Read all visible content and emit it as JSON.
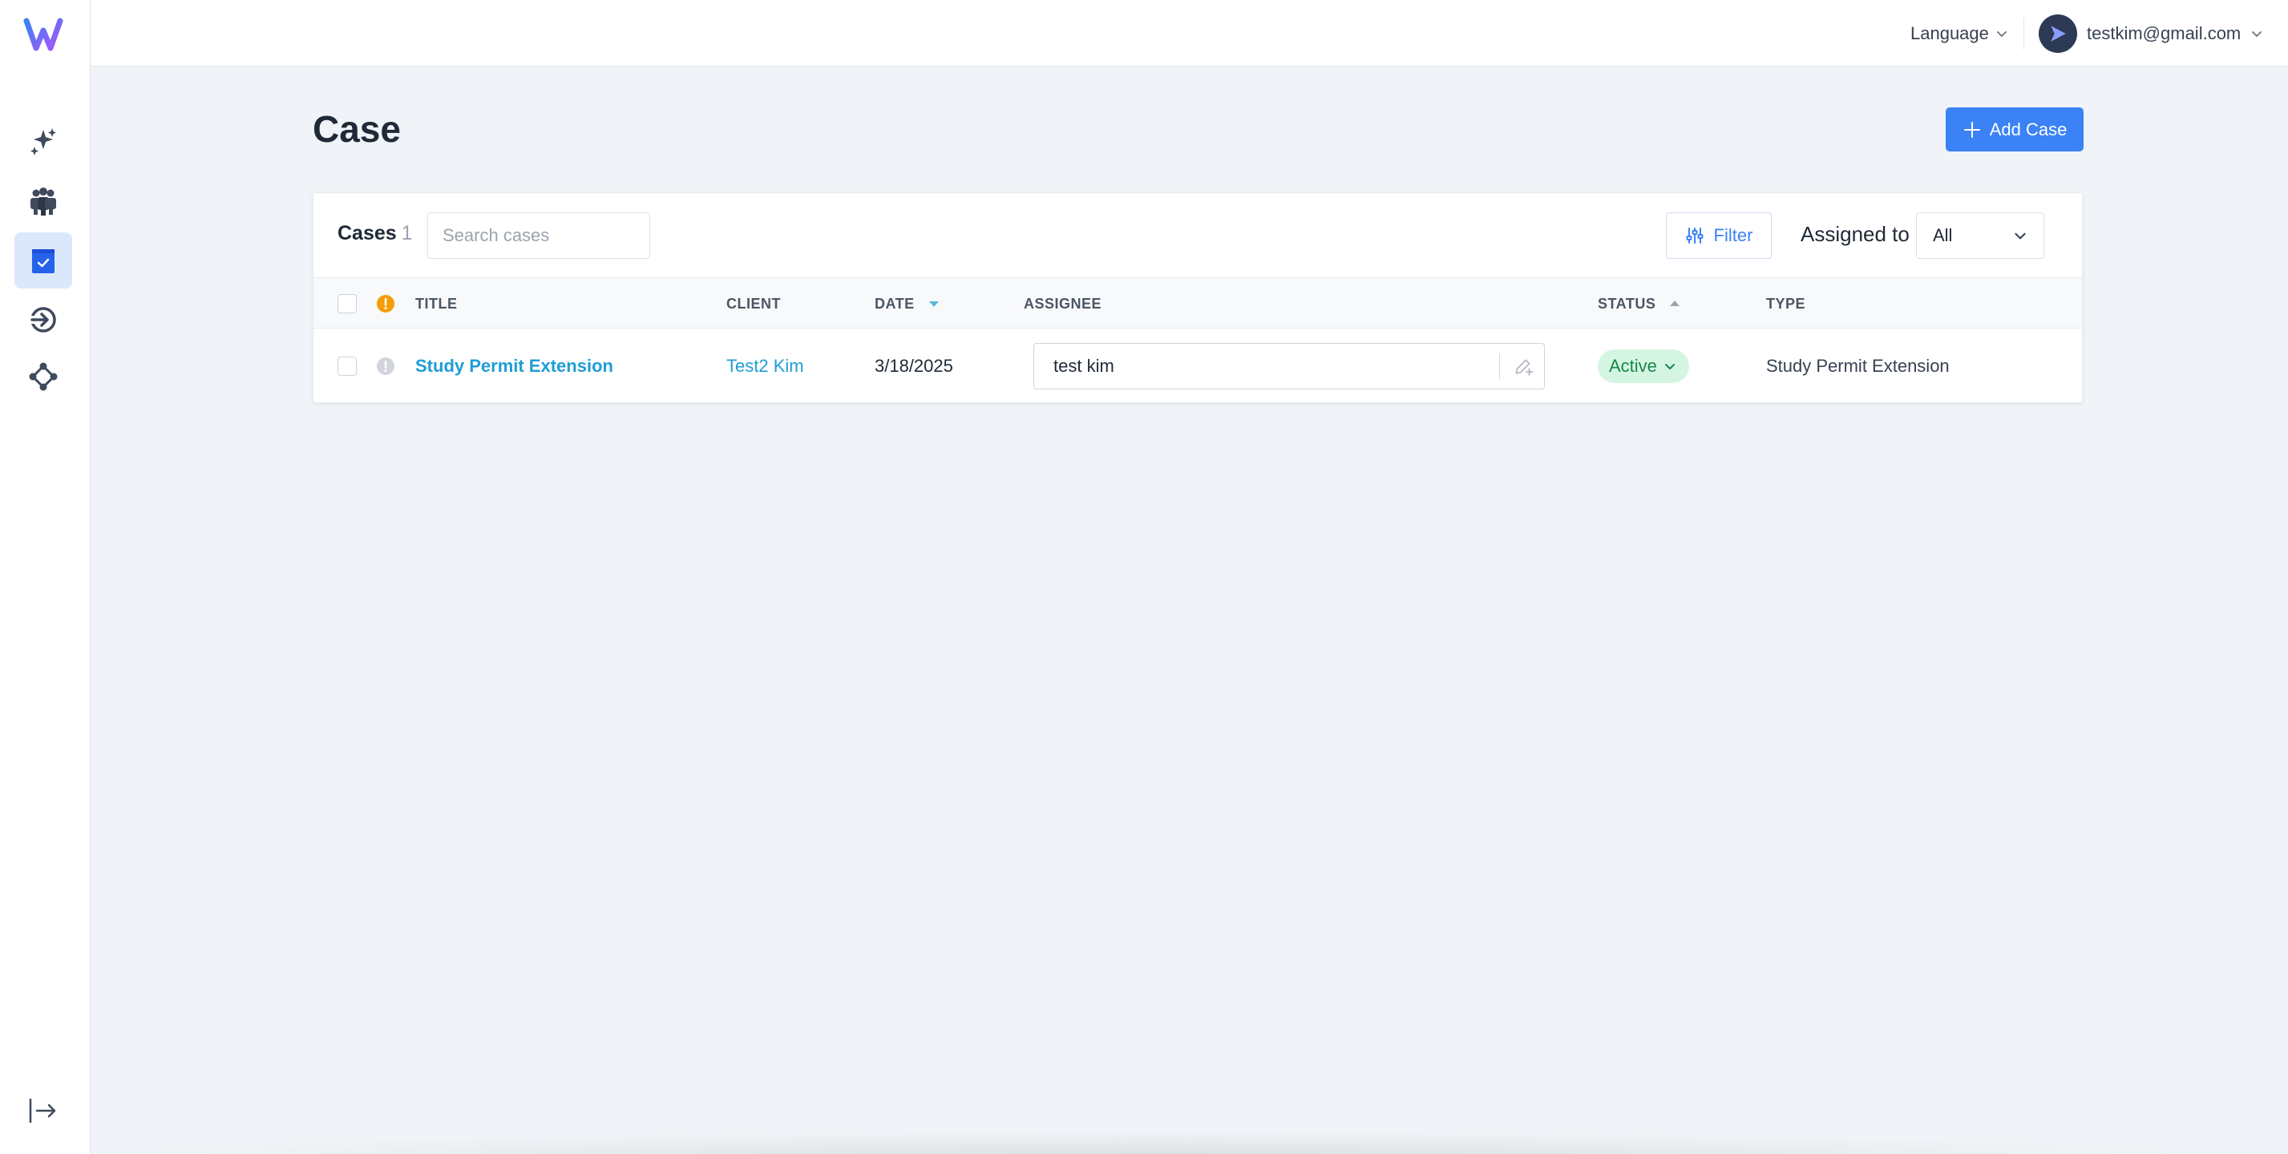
{
  "colors": {
    "accent": "#3b82f6",
    "link": "#1f9dd6",
    "status_active_bg": "#d5f5e3",
    "status_active_text": "#16894a",
    "priority_warning": "#f59e0b"
  },
  "sidebar": {
    "items": [
      {
        "name": "sparkles-icon",
        "active": false
      },
      {
        "name": "team-icon",
        "active": false
      },
      {
        "name": "cases-icon",
        "active": true
      },
      {
        "name": "login-icon",
        "active": false
      },
      {
        "name": "workflow-icon",
        "active": false
      }
    ],
    "collapse_icon": "collapse-arrow-icon"
  },
  "topbar": {
    "language_label": "Language",
    "user_email": "testkim@gmail.com"
  },
  "page": {
    "title": "Case",
    "add_button_label": "Add Case"
  },
  "cases_panel": {
    "label": "Cases",
    "count": "1",
    "search_placeholder": "Search cases",
    "filter_label": "Filter",
    "assigned_to_label": "Assigned to",
    "assigned_to_value": "All"
  },
  "table": {
    "columns": {
      "title": "TITLE",
      "client": "CLIENT",
      "date": "DATE",
      "assignee": "ASSIGNEE",
      "status": "STATUS",
      "type": "TYPE"
    },
    "rows": [
      {
        "title": "Study Permit Extension",
        "client": "Test2 Kim",
        "date": "3/18/2025",
        "assignee": "test kim",
        "status": "Active",
        "type": "Study Permit Extension"
      }
    ]
  }
}
